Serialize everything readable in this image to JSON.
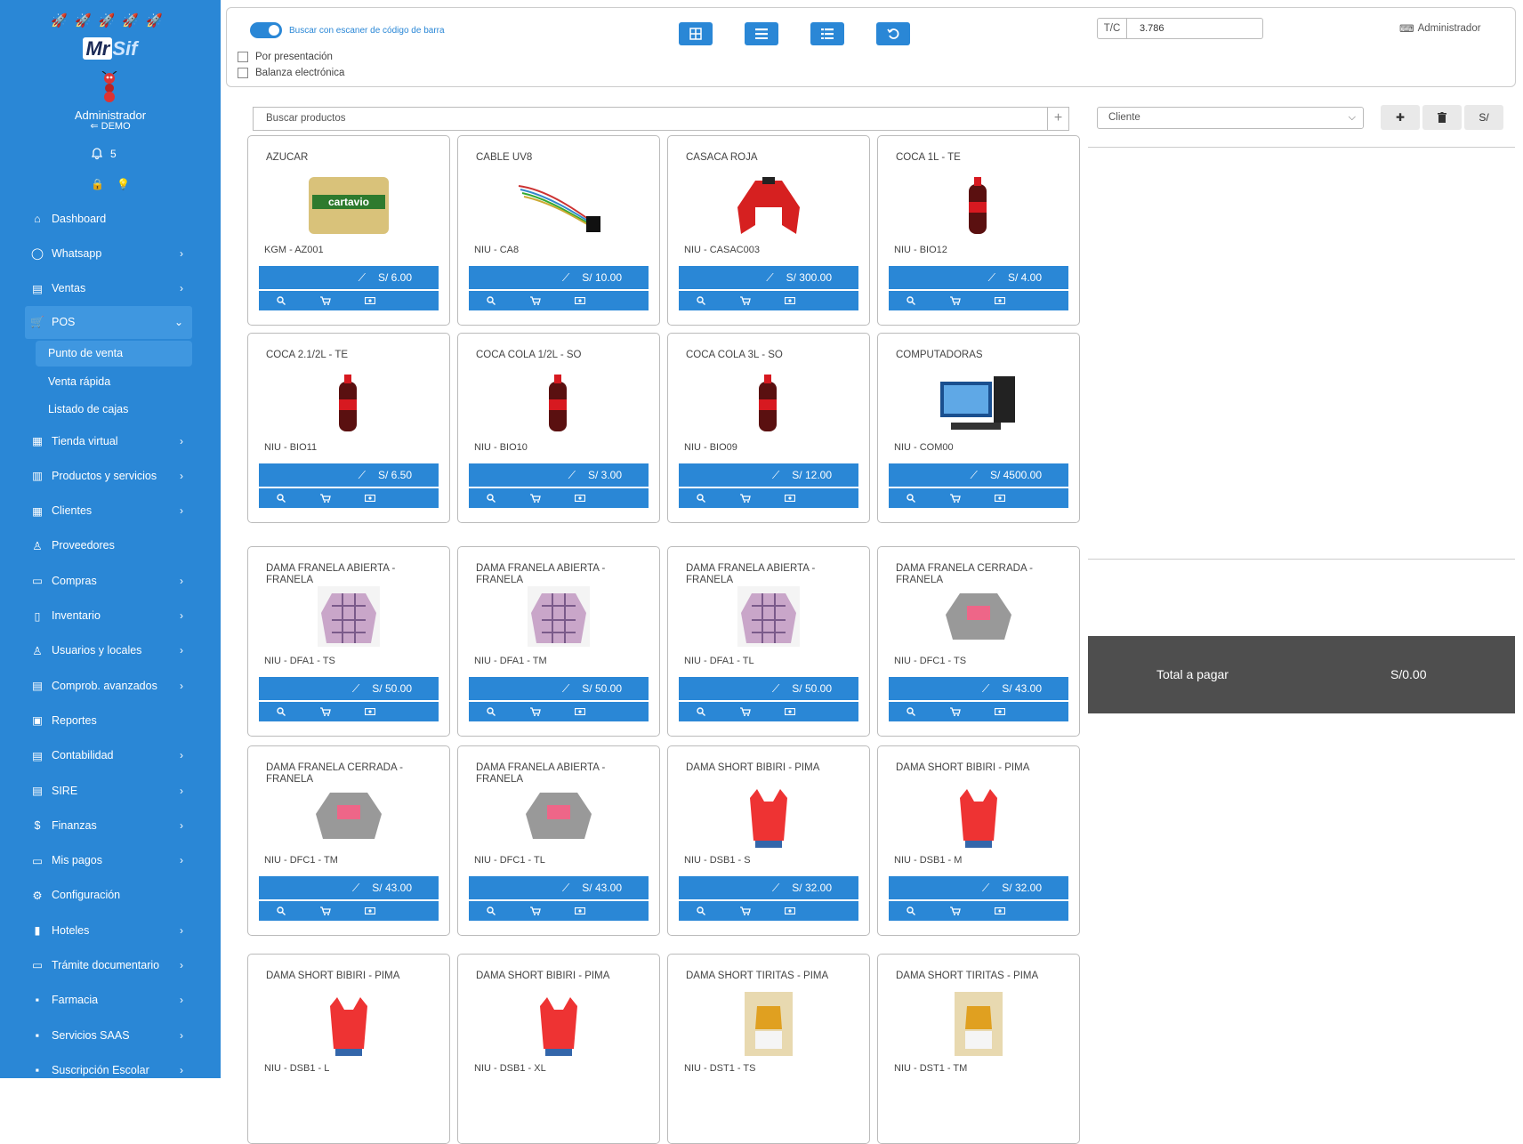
{
  "sidebar": {
    "brand": {
      "part1": "Mr",
      "part2": "Sif"
    },
    "user_name": "Administrador",
    "user_role": "DEMO",
    "notifications": "5",
    "menu": [
      {
        "label": "Dashboard",
        "icon": "home-icon",
        "chev": false
      },
      {
        "label": "Whatsapp",
        "icon": "whatsapp-icon",
        "chev": true
      },
      {
        "label": "Ventas",
        "icon": "file-icon",
        "chev": true
      },
      {
        "label": "POS",
        "icon": "cart-icon",
        "chev": true,
        "active": true,
        "sub": [
          "Punto de venta",
          "Venta rápida",
          "Listado de cajas"
        ]
      },
      {
        "label": "Tienda virtual",
        "icon": "store-icon",
        "chev": true
      },
      {
        "label": "Productos y servicios",
        "icon": "boxes-icon",
        "chev": true
      },
      {
        "label": "Clientes",
        "icon": "users-icon",
        "chev": true
      },
      {
        "label": "Proveedores",
        "icon": "user-icon",
        "chev": false
      },
      {
        "label": "Compras",
        "icon": "inbox-icon",
        "chev": true
      },
      {
        "label": "Inventario",
        "icon": "book-icon",
        "chev": true
      },
      {
        "label": "Usuarios y locales",
        "icon": "user-icon",
        "chev": true
      },
      {
        "label": "Comprob. avanzados",
        "icon": "file-icon",
        "chev": true
      },
      {
        "label": "Reportes",
        "icon": "chart-icon",
        "chev": false
      },
      {
        "label": "Contabilidad",
        "icon": "ledger-icon",
        "chev": true
      },
      {
        "label": "SIRE",
        "icon": "ledger-icon",
        "chev": true
      },
      {
        "label": "Finanzas",
        "icon": "dollar-icon",
        "chev": true
      },
      {
        "label": "Mis pagos",
        "icon": "money-icon",
        "chev": true
      },
      {
        "label": "Configuración",
        "icon": "gear-icon",
        "chev": false
      },
      {
        "label": "Hoteles",
        "icon": "building-icon",
        "chev": true
      },
      {
        "label": "Trámite documentario",
        "icon": "folder-icon",
        "chev": true
      },
      {
        "label": "Farmacia",
        "icon": "pill-icon",
        "chev": true
      },
      {
        "label": "Servicios SAAS",
        "icon": "cloud-icon",
        "chev": true
      },
      {
        "label": "Suscripción Escolar",
        "icon": "school-icon",
        "chev": true
      }
    ]
  },
  "topbar": {
    "barcode_label": "Buscar con escaner de código de barra",
    "by_presentation": "Por presentación",
    "scale": "Balanza electrónica",
    "tc_label": "T/C",
    "tc_value": "3.786",
    "admin": "Administrador"
  },
  "search": {
    "placeholder": "Buscar productos",
    "add": "+"
  },
  "client": {
    "placeholder": "Cliente",
    "currency_button": "S/"
  },
  "total": {
    "label": "Total a pagar",
    "value": "S/0.00"
  },
  "products": [
    {
      "name": "AZUCAR",
      "code": "KGM - AZ001",
      "price": "S/ 6.00",
      "img": "sugar-bag-image"
    },
    {
      "name": "CABLE UV8",
      "code": "NIU - CA8",
      "price": "S/ 10.00",
      "img": "cable-image"
    },
    {
      "name": "CASACA ROJA",
      "code": "NIU - CASAC003",
      "price": "S/ 300.00",
      "img": "red-jacket-image"
    },
    {
      "name": "COCA 1L - TE",
      "code": "NIU - BIO12",
      "price": "S/ 4.00",
      "img": "coca-bottle-image"
    },
    {
      "name": "COCA 2.1/2L - TE",
      "code": "NIU - BIO11",
      "price": "S/ 6.50",
      "img": "coca-bottle-image"
    },
    {
      "name": "COCA COLA 1/2L - SO",
      "code": "NIU - BIO10",
      "price": "S/ 3.00",
      "img": "coca-bottle-image"
    },
    {
      "name": "COCA COLA 3L - SO",
      "code": "NIU - BIO09",
      "price": "S/ 12.00",
      "img": "coca-bottle-image"
    },
    {
      "name": "COMPUTADORAS",
      "code": "NIU - COM00",
      "price": "S/ 4500.00",
      "img": "computer-image"
    },
    {
      "name": "DAMA FRANELA ABIERTA - FRANELA",
      "code": "NIU - DFA1 - TS",
      "price": "S/ 50.00",
      "img": "plaid-shirt-image"
    },
    {
      "name": "DAMA FRANELA ABIERTA - FRANELA",
      "code": "NIU - DFA1 - TM",
      "price": "S/ 50.00",
      "img": "plaid-shirt-image"
    },
    {
      "name": "DAMA FRANELA ABIERTA - FRANELA",
      "code": "NIU - DFA1 - TL",
      "price": "S/ 50.00",
      "img": "plaid-shirt-image"
    },
    {
      "name": "DAMA FRANELA CERRADA - FRANELA",
      "code": "NIU - DFC1 - TS",
      "price": "S/ 43.00",
      "img": "sweatshirt-image"
    },
    {
      "name": "DAMA FRANELA CERRADA - FRANELA",
      "code": "NIU - DFC1 - TM",
      "price": "S/ 43.00",
      "img": "sweatshirt-image"
    },
    {
      "name": "DAMA FRANELA ABIERTA - FRANELA",
      "code": "NIU - DFC1 - TL",
      "price": "S/ 43.00",
      "img": "sweatshirt-image"
    },
    {
      "name": "DAMA SHORT BIBIRI - PIMA",
      "code": "NIU - DSB1 - S",
      "price": "S/ 32.00",
      "img": "tank-top-image"
    },
    {
      "name": "DAMA SHORT BIBIRI - PIMA",
      "code": "NIU - DSB1 - M",
      "price": "S/ 32.00",
      "img": "tank-top-image"
    },
    {
      "name": "DAMA SHORT BIBIRI - PIMA",
      "code": "NIU - DSB1 - L",
      "price": "",
      "img": "tank-top-image"
    },
    {
      "name": "DAMA SHORT BIBIRI - PIMA",
      "code": "NIU - DSB1 - XL",
      "price": "",
      "img": "tank-top-image"
    },
    {
      "name": "DAMA SHORT TIRITAS - PIMA",
      "code": "NIU - DST1 - TS",
      "price": "",
      "img": "outfit-image"
    },
    {
      "name": "DAMA SHORT TIRITAS - PIMA",
      "code": "NIU - DST1 - TM",
      "price": "",
      "img": "outfit-image"
    }
  ],
  "colors": {
    "primary": "#2a87d6",
    "sidebar": "#2a87d6",
    "total_bg": "#4e4e4e"
  }
}
